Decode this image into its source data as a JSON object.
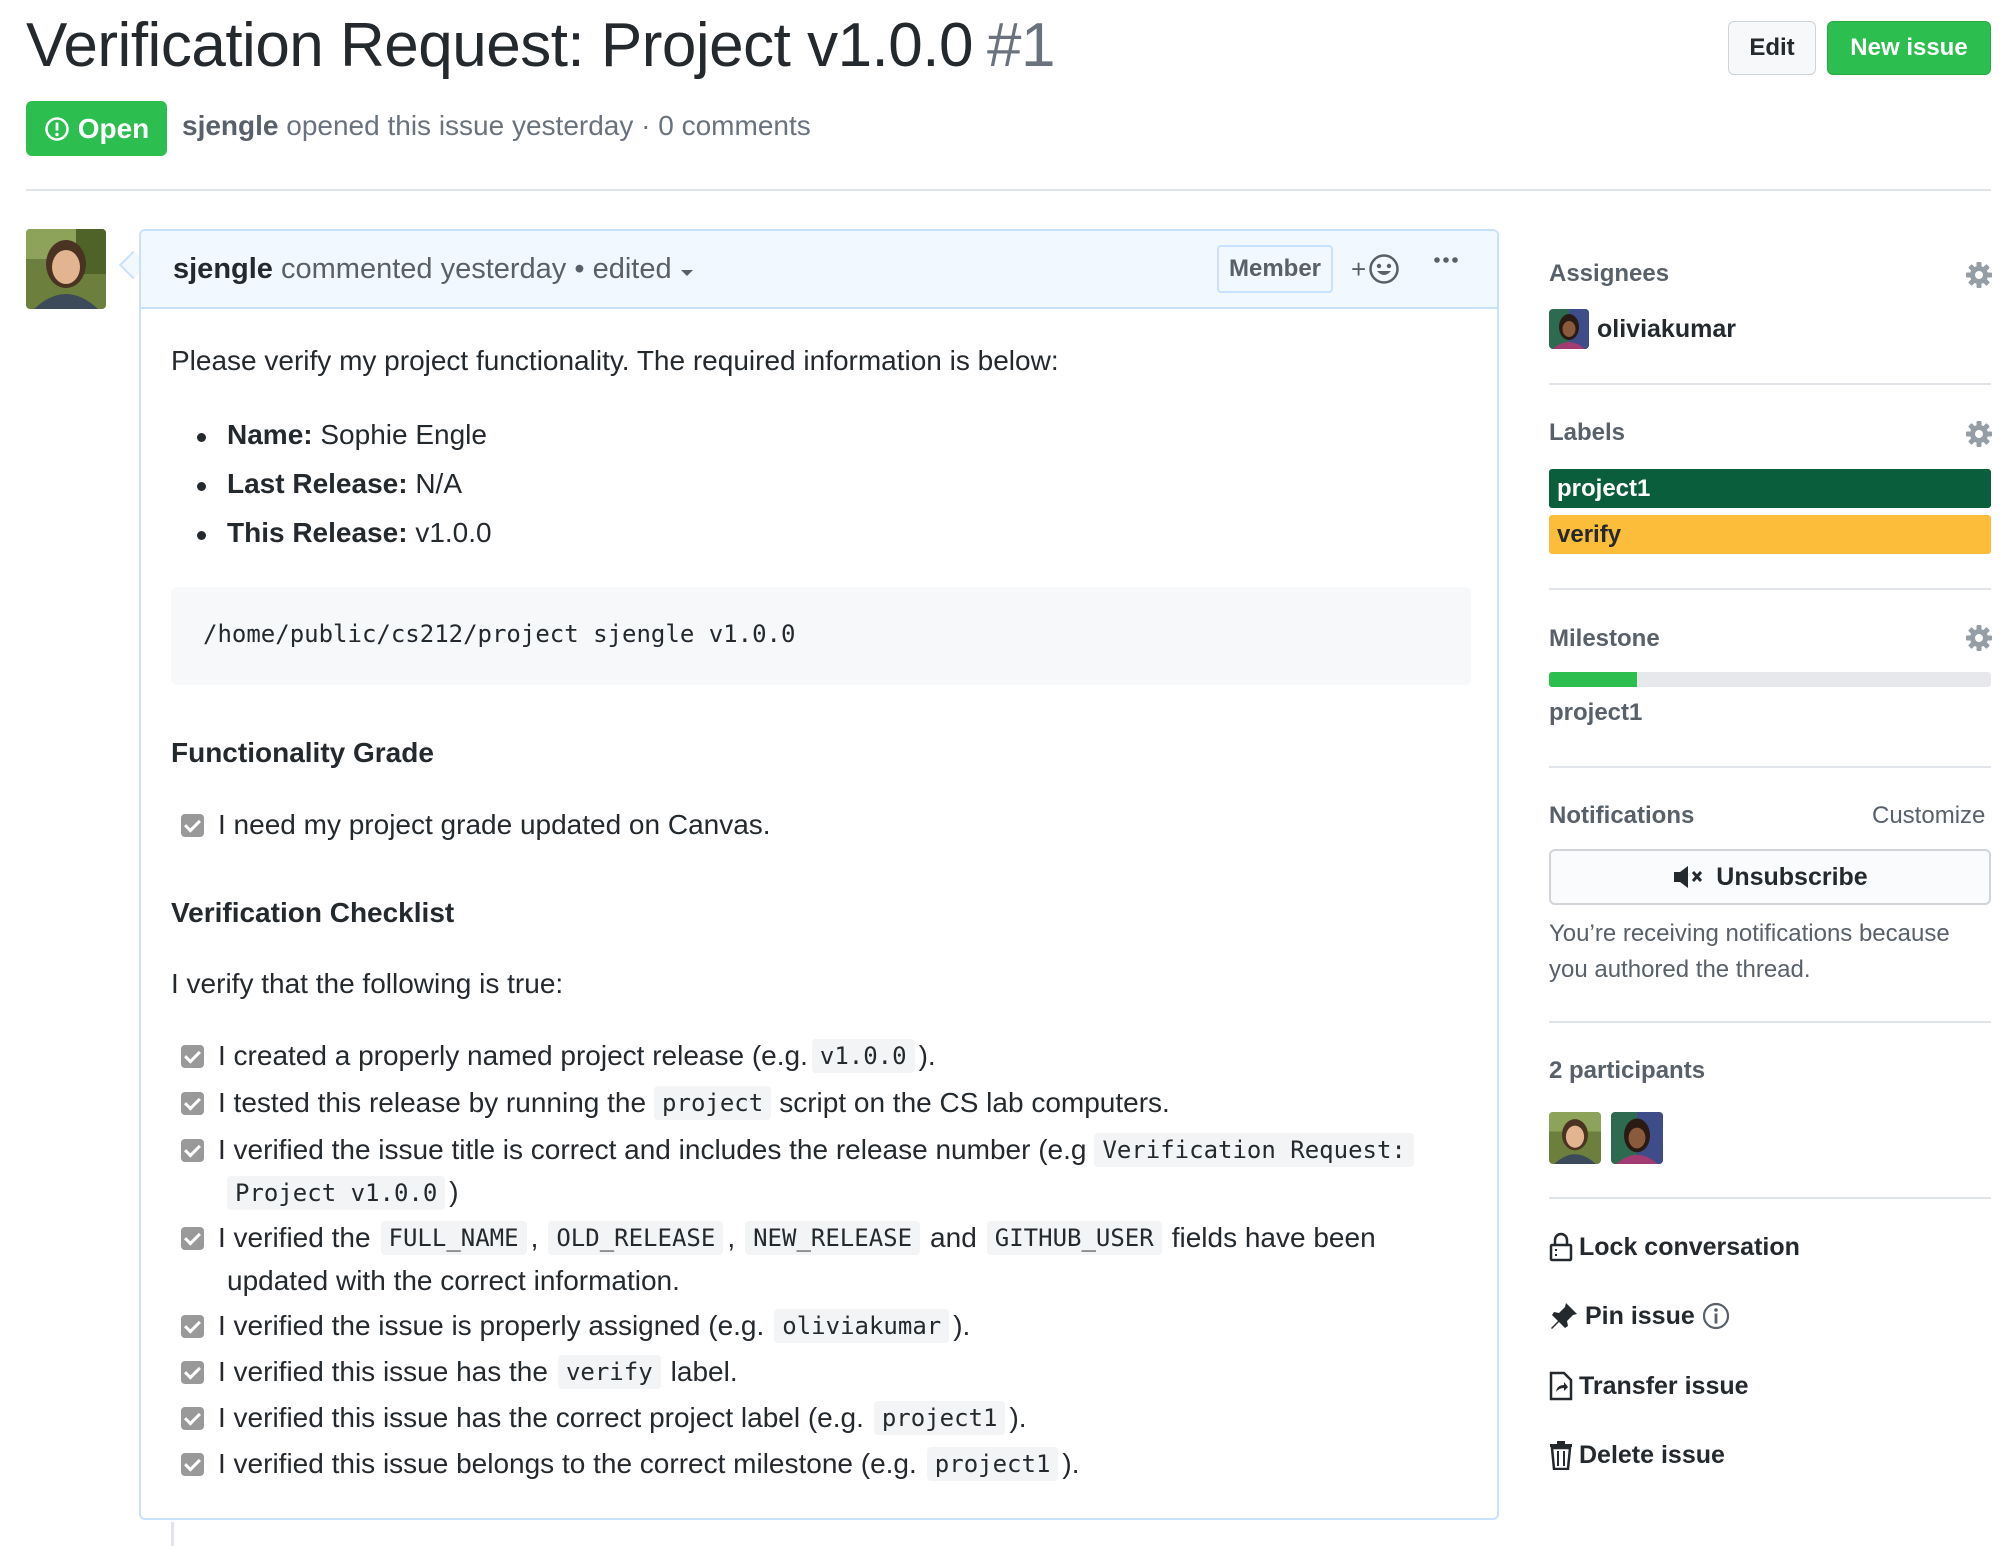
{
  "header": {
    "title": "Verification Request: Project v1.0.0",
    "number": "#1",
    "edit_label": "Edit",
    "new_issue_label": "New issue",
    "state_label": "Open",
    "author": "sjengle",
    "meta_text": "opened this issue yesterday · 0 comments"
  },
  "comment": {
    "author": "sjengle",
    "meta": "commented yesterday • edited",
    "badge": "Member",
    "intro": "Please verify my project functionality. The required information is below:",
    "info": [
      {
        "key": "Name:",
        "value": "Sophie Engle"
      },
      {
        "key": "Last Release:",
        "value": "N/A"
      },
      {
        "key": "This Release:",
        "value": "v1.0.0"
      }
    ],
    "command": "/home/public/cs212/project sjengle v1.0.0",
    "grade_heading": "Functionality Grade",
    "grade_task": "I need my project grade updated on Canvas.",
    "checklist_heading": "Verification Checklist",
    "checklist_intro": "I verify that the following is true:",
    "tasks": {
      "t1": {
        "a": "I created a properly named project release (e.g.",
        "code": "v1.0.0",
        "b": ")."
      },
      "t2": {
        "a": "I tested this release by running the",
        "code": "project",
        "b": "script on the CS lab computers."
      },
      "t3": {
        "a": "I verified the issue title is correct and includes the release number (e.g",
        "code": "Verification Request:",
        "code2": "Project v1.0.0",
        "b": ")"
      },
      "t4": {
        "a": "I verified the",
        "c1": "FULL_NAME",
        "sep1": ",",
        "c2": "OLD_RELEASE",
        "sep2": ",",
        "c3": "NEW_RELEASE",
        "and": "and",
        "c4": "GITHUB_USER",
        "b": "fields have been",
        "cont": "updated with the correct information."
      },
      "t5": {
        "a": "I verified the issue is properly assigned (e.g.",
        "code": "oliviakumar",
        "b": ")."
      },
      "t6": {
        "a": "I verified this issue has the",
        "code": "verify",
        "b": "label."
      },
      "t7": {
        "a": "I verified this issue has the correct project label (e.g.",
        "code": "project1",
        "b": ")."
      },
      "t8": {
        "a": "I verified this issue belongs to the correct milestone (e.g.",
        "code": "project1",
        "b": ")."
      }
    }
  },
  "sidebar": {
    "assignees_heading": "Assignees",
    "assignee": "oliviakumar",
    "labels_heading": "Labels",
    "labels": [
      {
        "name": "project1",
        "color": "#0b5e3c",
        "text_color": "#ffffff"
      },
      {
        "name": "verify",
        "color": "#fbbd3a",
        "text_color": "#24292e"
      }
    ],
    "milestone_heading": "Milestone",
    "milestone_progress_pct": 20,
    "milestone_name": "project1",
    "notifications_heading": "Notifications",
    "customize_label": "Customize",
    "unsubscribe_label": "Unsubscribe",
    "notif_reason": "You’re receiving notifications because you authored the thread.",
    "participants_heading": "2 participants",
    "actions": {
      "lock": "Lock conversation",
      "pin": "Pin issue",
      "transfer": "Transfer issue",
      "delete": "Delete issue"
    }
  },
  "colors": {
    "green": "#2cbe4e",
    "blue_border": "#c8e1ff",
    "blue_bg": "#f1f8ff"
  }
}
